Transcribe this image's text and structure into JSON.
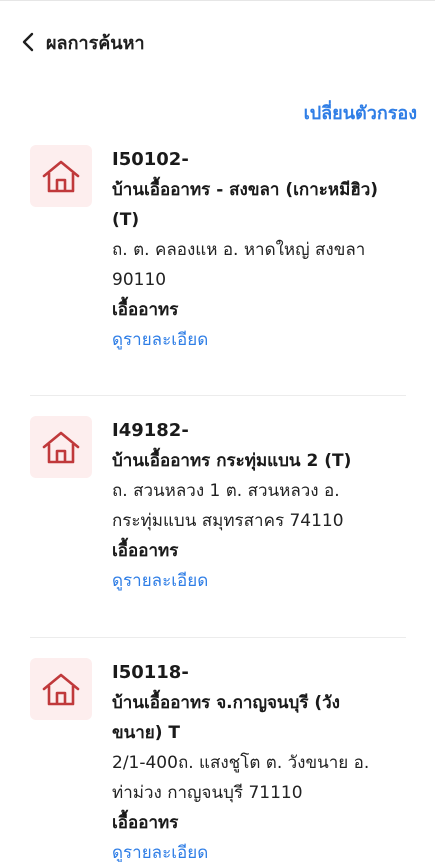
{
  "header": {
    "title": "ผลการค้นหา"
  },
  "actions": {
    "filter_label": "เปลี่ยนตัวกรอง"
  },
  "colors": {
    "accent": "#2f7ee6",
    "icon": "#c0393b",
    "icon_bg": "#fdeeee"
  },
  "results": [
    {
      "code": "I50102-",
      "name": "บ้านเอื้ออาทร - สงขลา (เกาะหมีฮิว)(T)",
      "address": "ถ. ต. คลองแห อ. หาดใหญ่ สงขลา 90110",
      "type": "เอื้ออาทร",
      "detail_label": "ดูรายละเอียด"
    },
    {
      "code": "I49182-",
      "name": "บ้านเอื้ออาทร กระทุ่มแบน 2 (T)",
      "address": "ถ. สวนหลวง 1 ต. สวนหลวง อ. กระทุ่มแบน สมุทรสาคร 74110",
      "type": "เอื้ออาทร",
      "detail_label": "ดูรายละเอียด"
    },
    {
      "code": "I50118-",
      "name": "บ้านเอื้ออาทร จ.กาญจนบุรี (วังขนาย) T",
      "address": "2/1-400ถ. แสงชูโต ต. วังขนาย อ. ท่าม่วง กาญจนบุรี 71110",
      "type": "เอื้ออาทร",
      "detail_label": "ดูรายละเอียด"
    }
  ]
}
